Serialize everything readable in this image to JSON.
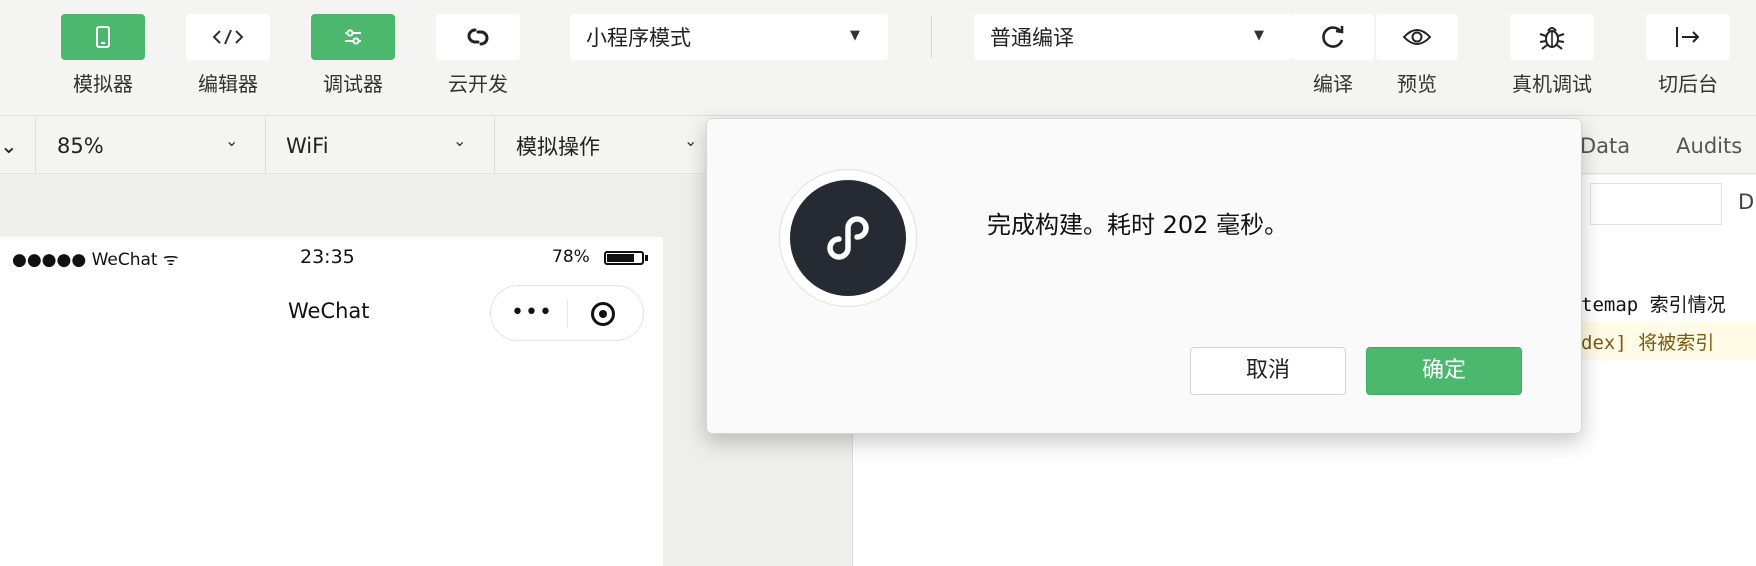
{
  "toolbar": {
    "simulator": {
      "label": "模拟器",
      "icon": "phone-icon"
    },
    "editor": {
      "label": "编辑器",
      "icon": "code-icon"
    },
    "debugger": {
      "label": "调试器",
      "icon": "sliders-icon"
    },
    "cloud": {
      "label": "云开发",
      "icon": "cloud-link-icon"
    },
    "mode_select": "小程序模式",
    "compile_select": "普通编译",
    "compile": {
      "label": "编译",
      "icon": "refresh-icon"
    },
    "preview": {
      "label": "预览",
      "icon": "eye-icon"
    },
    "remote_debug": {
      "label": "真机调试",
      "icon": "bug-icon"
    },
    "background": {
      "label": "切后台",
      "icon": "switch-icon"
    },
    "accent_color": "#4cb86d"
  },
  "subbar": {
    "zoom": "85%",
    "network": "WiFi",
    "simulate": "模拟操作"
  },
  "phone": {
    "carrier": "●●●●● WeChat",
    "time": "23:35",
    "battery": "78%",
    "battery_level": 0.78,
    "nav_title": "WeChat",
    "capsule_dots": "•••"
  },
  "devtools": {
    "tab_data": "Data",
    "tab_audits": "Audits",
    "filter_suffix": "D",
    "line1": "temap 索引情况",
    "line2": "dex] 将被索引"
  },
  "dialog": {
    "message": "完成构建。耗时 202 毫秒。",
    "cancel": "取消",
    "confirm": "确定"
  }
}
